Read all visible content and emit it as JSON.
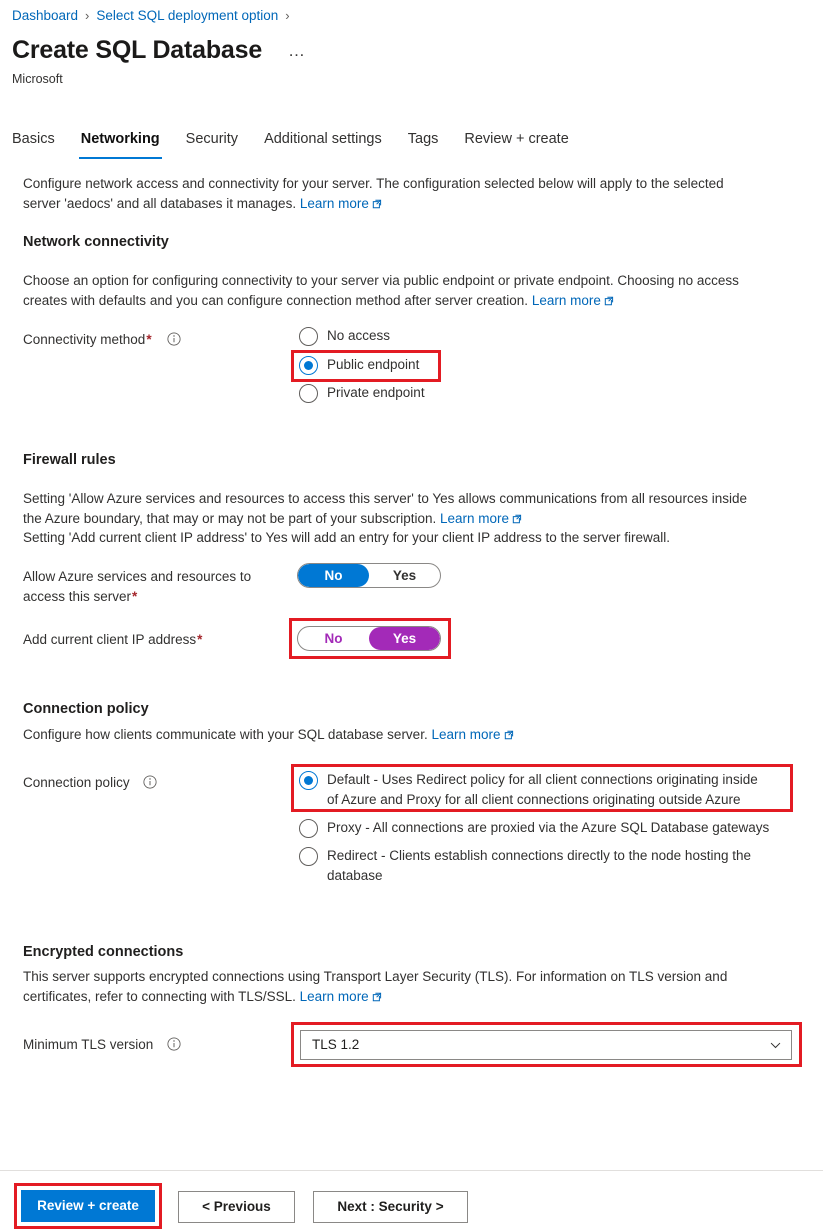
{
  "breadcrumb": {
    "items": [
      {
        "label": "Dashboard"
      },
      {
        "label": "Select SQL deployment option"
      }
    ],
    "separator": "›"
  },
  "header": {
    "title": "Create SQL Database",
    "subtitle": "Microsoft",
    "more_actions": "…"
  },
  "tabs": [
    {
      "label": "Basics",
      "active": false
    },
    {
      "label": "Networking",
      "active": true
    },
    {
      "label": "Security",
      "active": false
    },
    {
      "label": "Additional settings",
      "active": false
    },
    {
      "label": "Tags",
      "active": false
    },
    {
      "label": "Review + create",
      "active": false
    }
  ],
  "intro": {
    "line1": "Configure network access and connectivity for your server. The configuration selected below will apply to the selected",
    "line2": "server 'aedocs' and all databases it manages.",
    "learn_more": "Learn more"
  },
  "network_connectivity": {
    "heading": "Network connectivity",
    "desc_line1": "Choose an option for configuring connectivity to your server via public endpoint or private endpoint. Choosing no access",
    "desc_line2": "creates with defaults and you can configure connection method after server creation.",
    "learn_more": "Learn more",
    "field_label": "Connectivity method",
    "required_marker": "*",
    "info_icon": "info-icon",
    "options": [
      {
        "label": "No access",
        "selected": false
      },
      {
        "label": "Public endpoint",
        "selected": true
      },
      {
        "label": "Private endpoint",
        "selected": false
      }
    ]
  },
  "firewall_rules": {
    "heading": "Firewall rules",
    "desc_line1": "Setting 'Allow Azure services and resources to access this server' to Yes allows communications from all resources inside",
    "desc_line2": "the Azure boundary, that may or may not be part of your subscription.",
    "learn_more": "Learn more",
    "desc_line3": "Setting 'Add current client IP address' to Yes will add an entry for your client IP address to the server firewall.",
    "allow_azure": {
      "label_line1": "Allow Azure services and resources to",
      "label_line2": "access this server",
      "required_marker": "*",
      "option_no": "No",
      "option_yes": "Yes",
      "selected": "No"
    },
    "add_client_ip": {
      "label": "Add current client IP address",
      "required_marker": "*",
      "option_no": "No",
      "option_yes": "Yes",
      "selected": "Yes"
    }
  },
  "connection_policy": {
    "heading": "Connection policy",
    "desc": "Configure how clients communicate with your SQL database server.",
    "learn_more": "Learn more",
    "field_label": "Connection policy",
    "info_icon": "info-icon",
    "options": [
      {
        "line1": "Default - Uses Redirect policy for all client connections originating inside",
        "line2": "of Azure and Proxy for all client connections originating outside Azure",
        "selected": true
      },
      {
        "line1": "Proxy - All connections are proxied via the Azure SQL Database gateways",
        "line2": "",
        "selected": false
      },
      {
        "line1": "Redirect - Clients establish connections directly to the node hosting the",
        "line2": "database",
        "selected": false
      }
    ]
  },
  "encrypted_connections": {
    "heading": "Encrypted connections",
    "desc_line1": "This server supports encrypted connections using Transport Layer Security (TLS). For information on TLS version and",
    "desc_line2": "certificates, refer to connecting with TLS/SSL.",
    "learn_more": "Learn more",
    "field_label": "Minimum TLS version",
    "info_icon": "info-icon",
    "tls_value": "TLS 1.2",
    "chevron_icon": "chevron-down-icon"
  },
  "footer": {
    "review_create": "Review + create",
    "previous": "< Previous",
    "next": "Next : Security >"
  },
  "colors": {
    "accent_blue": "#0078d4",
    "link_blue": "#0067b8",
    "toggle_purple": "#a32ab8",
    "annotation_red": "#e31b23",
    "required_red": "#a4262c"
  }
}
